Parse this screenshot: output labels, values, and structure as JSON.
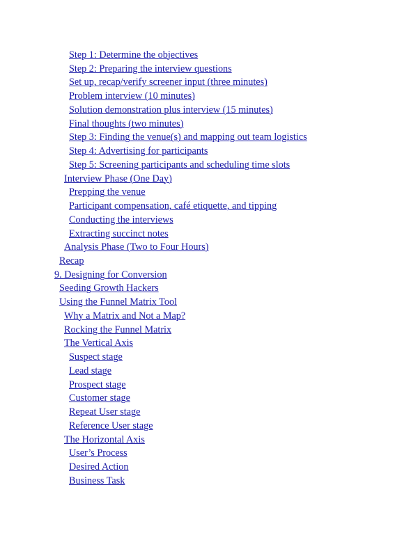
{
  "toc": {
    "link_color": "#1a1aa6",
    "entries": [
      {
        "level": 3,
        "text": "Step 1: Determine the objectives"
      },
      {
        "level": 3,
        "text": "Step 2: Preparing the interview questions"
      },
      {
        "level": 3,
        "text": "Set up, recap/verify screener input (three minutes)"
      },
      {
        "level": 3,
        "text": "Problem interview (10 minutes)"
      },
      {
        "level": 3,
        "text": "Solution demonstration plus interview (15 minutes)"
      },
      {
        "level": 3,
        "text": "Final thoughts (two minutes)"
      },
      {
        "level": 3,
        "text": "Step 3: Finding the venue(s) and mapping out team logistics"
      },
      {
        "level": 3,
        "text": "Step 4: Advertising for participants"
      },
      {
        "level": 3,
        "text": "Step 5: Screening participants and scheduling time slots"
      },
      {
        "level": 2,
        "text": "Interview Phase (One Day)"
      },
      {
        "level": 3,
        "text": "Prepping the venue"
      },
      {
        "level": 3,
        "text": "Participant compensation, café etiquette, and tipping"
      },
      {
        "level": 3,
        "text": "Conducting the interviews"
      },
      {
        "level": 3,
        "text": "Extracting succinct notes"
      },
      {
        "level": 2,
        "text": "Analysis Phase (Two to Four Hours)"
      },
      {
        "level": 1,
        "text": "Recap"
      },
      {
        "level": 0,
        "text": "9. Designing for Conversion"
      },
      {
        "level": 1,
        "text": "Seeding Growth Hackers"
      },
      {
        "level": 1,
        "text": "Using the Funnel Matrix Tool"
      },
      {
        "level": 2,
        "text": "Why a Matrix and Not a Map?"
      },
      {
        "level": 2,
        "text": "Rocking the Funnel Matrix"
      },
      {
        "level": 2,
        "text": "The Vertical Axis"
      },
      {
        "level": 3,
        "text": "Suspect stage"
      },
      {
        "level": 3,
        "text": "Lead stage"
      },
      {
        "level": 3,
        "text": "Prospect stage"
      },
      {
        "level": 3,
        "text": "Customer stage"
      },
      {
        "level": 3,
        "text": "Repeat User stage"
      },
      {
        "level": 3,
        "text": "Reference User stage"
      },
      {
        "level": 2,
        "text": "The Horizontal Axis"
      },
      {
        "level": 3,
        "text": "User’s Process"
      },
      {
        "level": 3,
        "text": "Desired Action"
      },
      {
        "level": 3,
        "text": "Business Task"
      }
    ]
  }
}
